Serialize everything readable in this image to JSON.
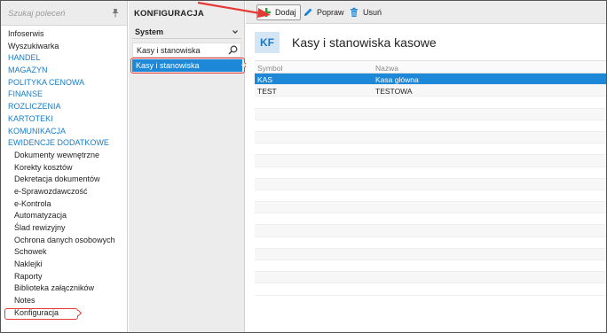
{
  "sidebar": {
    "search_placeholder": "Szukaj poleceń",
    "items": [
      {
        "label": "Infoserwis",
        "style": "plain"
      },
      {
        "label": "Wyszukiwarka",
        "style": "plain"
      },
      {
        "label": "HANDEL",
        "style": "blue"
      },
      {
        "label": "MAGAZYN",
        "style": "blue"
      },
      {
        "label": "POLITYKA CENOWA",
        "style": "blue"
      },
      {
        "label": "FINANSE",
        "style": "blue"
      },
      {
        "label": "ROZLICZENIA",
        "style": "blue"
      },
      {
        "label": "KARTOTEKI",
        "style": "blue"
      },
      {
        "label": "KOMUNIKACJA",
        "style": "blue"
      },
      {
        "label": "EWIDENCJE DODATKOWE",
        "style": "blue"
      },
      {
        "label": "Dokumenty wewnętrzne",
        "style": "sub"
      },
      {
        "label": "Korekty kosztów",
        "style": "sub"
      },
      {
        "label": "Dekretacja dokumentów",
        "style": "sub"
      },
      {
        "label": "e-Sprawozdawczość",
        "style": "sub"
      },
      {
        "label": "e-Kontrola",
        "style": "sub"
      },
      {
        "label": "Automatyzacja",
        "style": "sub"
      },
      {
        "label": "Ślad rewizyjny",
        "style": "sub"
      },
      {
        "label": "Ochrona danych osobowych",
        "style": "sub"
      },
      {
        "label": "Schowek",
        "style": "sub"
      },
      {
        "label": "Naklejki",
        "style": "sub"
      },
      {
        "label": "Raporty",
        "style": "sub"
      },
      {
        "label": "Biblioteka załączników",
        "style": "sub"
      },
      {
        "label": "Notes",
        "style": "sub"
      },
      {
        "label": "Konfiguracja",
        "style": "sub-highlight"
      }
    ]
  },
  "config_panel": {
    "title": "KONFIGURACJA",
    "group_select": "System",
    "filter_value": "Kasy i stanowiska",
    "selected_item": "Kasy i stanowiska"
  },
  "toolbar": {
    "add_label": "Dodaj",
    "edit_label": "Popraw",
    "delete_label": "Usuń"
  },
  "content": {
    "badge": "KF",
    "title": "Kasy i stanowiska kasowe",
    "columns": [
      "Symbol",
      "Nazwa"
    ],
    "rows": [
      {
        "symbol": "KAS",
        "name": "Kasa główna",
        "selected": true
      },
      {
        "symbol": "TEST",
        "name": "TESTOWA",
        "selected": false
      }
    ],
    "empty_rows": 17
  },
  "colors": {
    "accent": "#1e88d8",
    "menu_blue": "#1a7bc4",
    "highlight_red": "#e53935",
    "add_green": "#2e9e3e",
    "delete_blue": "#1e88d8"
  }
}
